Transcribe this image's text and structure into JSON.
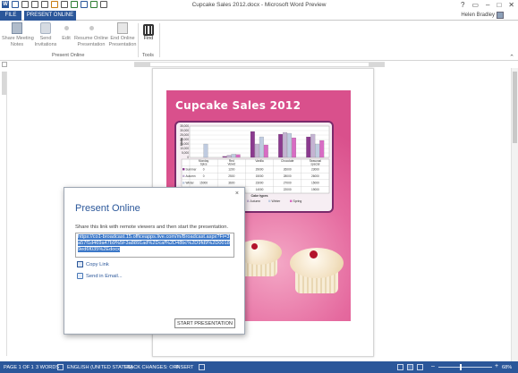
{
  "window": {
    "title": "Cupcake Sales 2012.docx - Microsoft Word Preview",
    "controls": [
      "?",
      "▭",
      "–",
      "□",
      "✕"
    ]
  },
  "tabs": {
    "file": "FILE",
    "present_online": "PRESENT ONLINE"
  },
  "user": {
    "name": "Helen Bradley"
  },
  "ribbon": {
    "share_meeting_notes": "Share Meeting\nNotes",
    "send_invitations": "Send\nInvitations",
    "edit": "Edit",
    "resume_online_presentation": "Resume Online\nPresentation",
    "end_online_presentation": "End Online\nPresentation",
    "find": "Find",
    "group_present_online": "Present Online",
    "group_tools": "Tools"
  },
  "document": {
    "cover_title": "Cupcake Sales 2012"
  },
  "chart_data": {
    "type": "bar",
    "title": "",
    "xlabel": "Cake types",
    "ylabel": "Units",
    "ylim": [
      0,
      35000
    ],
    "y_ticks": [
      "35,000",
      "30,000",
      "25,000",
      "20,000",
      "15,000",
      "10,000",
      "5,000",
      "0"
    ],
    "categories": [
      "Monday Spice",
      "Red Velvet",
      "Vanilla",
      "Chocolate",
      "Seasonal special"
    ],
    "series": [
      {
        "name": "Summer",
        "color": "#8b3a8f",
        "values": [
          0,
          1200,
          29000,
          26000,
          23000
        ]
      },
      {
        "name": "Autumn",
        "color": "#c4b3d2",
        "values": [
          0,
          2500,
          15000,
          28000,
          26000
        ]
      },
      {
        "name": "Winter",
        "color": "#bfcbe0",
        "values": [
          15000,
          3600,
          23000,
          27000,
          15000
        ]
      },
      {
        "name": "Spring",
        "color": "#d86cc4",
        "values": [
          0,
          3200,
          14000,
          22000,
          19000
        ]
      }
    ],
    "legend_position": "bottom"
  },
  "dialog": {
    "close": "×",
    "title": "Present Online",
    "description": "Share this link with remote viewers and then start the presentation.",
    "link": "https://co1-broadcast.15.officeapps.live.com/m/Broadcast.aspx?Fi=3a57f1d469a47b9%5F3a8891ad%2Dcaf%2D48bc%2D9fd9%2D00189ed6f035%2Edocx",
    "copy_link": "Copy Link",
    "send_email": "Send in Email...",
    "start_button": "START PRESENTATION"
  },
  "status": {
    "page": "PAGE 1 OF 1",
    "words": "3 WORDS",
    "language": "ENGLISH (UNITED STATES)",
    "track_changes": "TRACK CHANGES: OFF",
    "mode": "INSERT",
    "zoom": "68%",
    "zoom_minus": "–",
    "zoom_plus": "+"
  }
}
